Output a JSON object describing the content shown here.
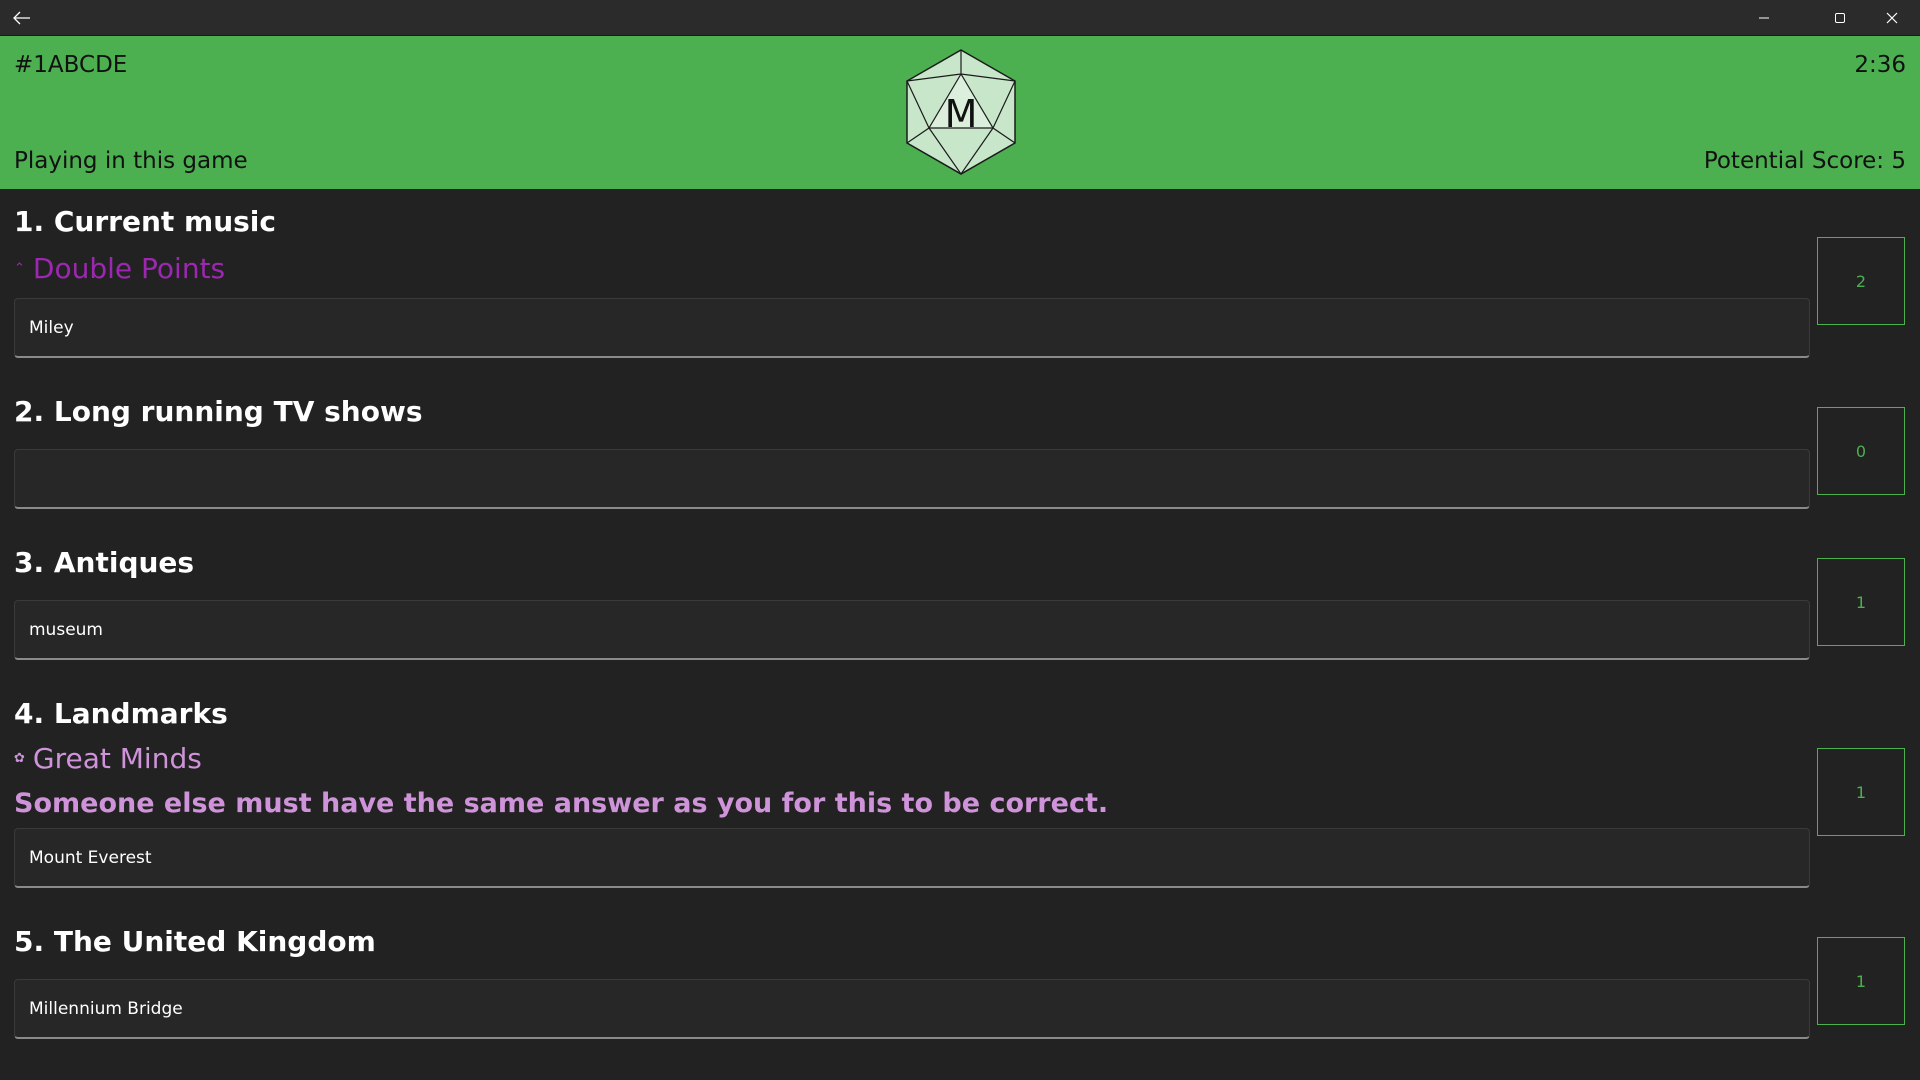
{
  "window": {
    "back_icon": "arrow-left-icon",
    "minimize_icon": "minimize-icon",
    "maximize_icon": "maximize-icon",
    "close_icon": "close-icon"
  },
  "header": {
    "game_code": "#1ABCDE",
    "timer": "2:36",
    "status": "Playing in this game",
    "potential_score": "Potential Score: 5",
    "logo_letter": "M",
    "background_color": "#4caf50"
  },
  "questions": [
    {
      "title": "1. Current music",
      "modifier": {
        "label": "Double Points",
        "icon": "chevron-up-double-icon",
        "color": "#9c27b0"
      },
      "answer": "Miley",
      "points": "2"
    },
    {
      "title": "2. Long running TV shows",
      "answer": "",
      "points": "0"
    },
    {
      "title": "3. Antiques",
      "answer": "museum",
      "points": "1"
    },
    {
      "title": "4. Landmarks",
      "modifier": {
        "label": "Great Minds",
        "icon": "brain-icon",
        "color": "#ce93d8",
        "description": "Someone else must have the same answer as you for this to be correct."
      },
      "answer": "Mount Everest",
      "points": "1"
    },
    {
      "title": "5. The United Kingdom",
      "answer": "Millennium Bridge",
      "points": "1"
    }
  ]
}
